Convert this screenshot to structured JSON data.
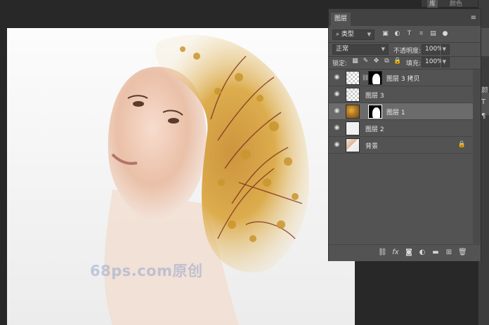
{
  "document": {
    "watermark": "68ps.com原创"
  },
  "top_right_tabs": [
    "库",
    "颜色"
  ],
  "layers_panel": {
    "tab": "图层",
    "filter": {
      "value": "类型"
    },
    "blend_mode": "正常",
    "opacity_label": "不透明度:",
    "opacity_value": "100%",
    "lock_label": "锁定:",
    "fill_label": "填充:",
    "fill_value": "100%",
    "layers": [
      {
        "name": "图层 3 拷贝",
        "thumb": "face",
        "mask": true,
        "visible": true,
        "selected": false
      },
      {
        "name": "图层 3",
        "thumb": "face",
        "mask": false,
        "visible": true,
        "selected": false
      },
      {
        "name": "图层 1",
        "thumb": "tree",
        "mask": true,
        "visible": true,
        "selected": true
      },
      {
        "name": "图层 2",
        "thumb": "white",
        "mask": false,
        "visible": true,
        "selected": false
      },
      {
        "name": "背景",
        "thumb": "face",
        "mask": false,
        "visible": true,
        "selected": false,
        "locked": true
      }
    ],
    "bottom_icons": [
      "link-layers-icon",
      "fx-icon",
      "add-mask-icon",
      "adjustment-layer-icon",
      "group-folder-icon",
      "new-layer-icon",
      "trash-icon"
    ]
  },
  "side_panel_glyphs": [
    "颜",
    "T",
    "¶"
  ]
}
